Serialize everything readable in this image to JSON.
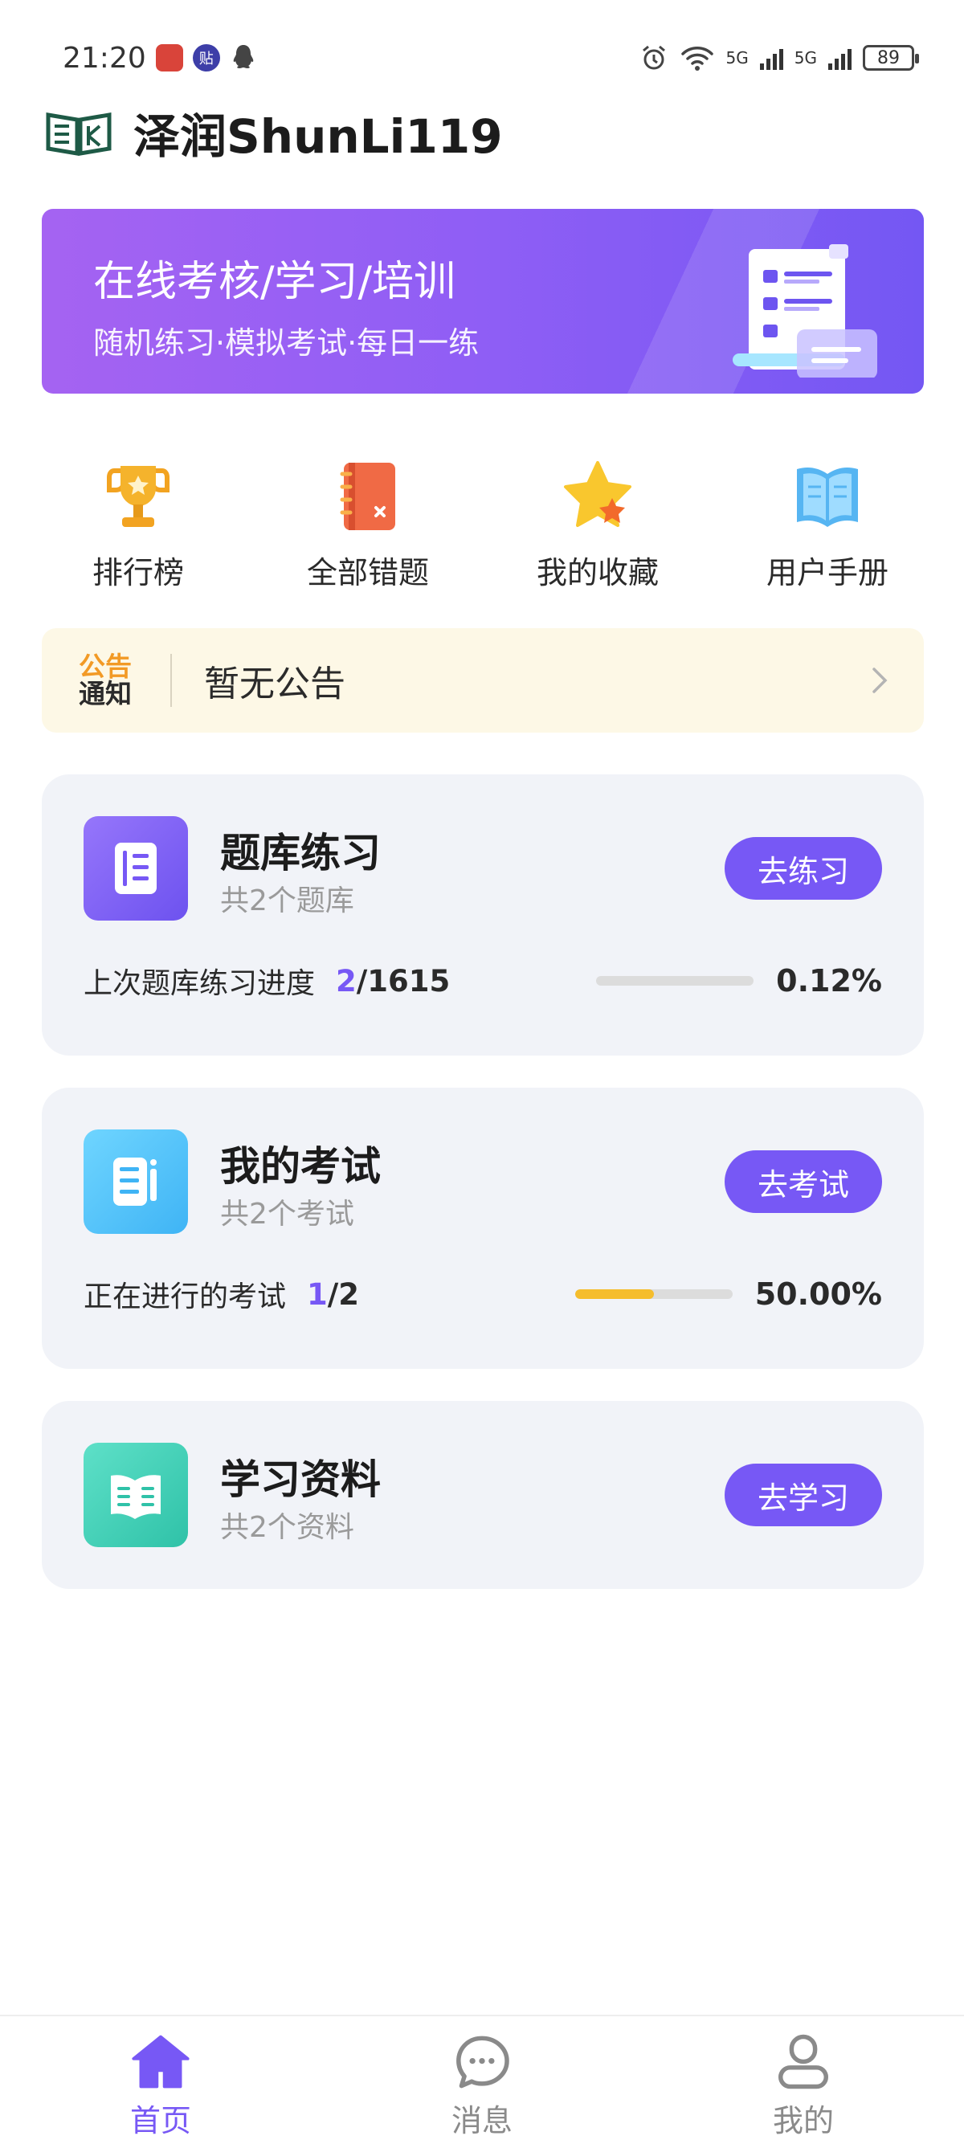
{
  "status_bar": {
    "time": "21:20",
    "app_icon_1": "贴",
    "network_1": "5G",
    "network_2": "5G",
    "battery": "89"
  },
  "header": {
    "app_title": "泽润ShunLi119"
  },
  "banner": {
    "title": "在线考核/学习/培训",
    "subtitle": "随机练习·模拟考试·每日一练"
  },
  "quick_menu": [
    {
      "label": "排行榜",
      "icon": "trophy-icon"
    },
    {
      "label": "全部错题",
      "icon": "notebook-icon"
    },
    {
      "label": "我的收藏",
      "icon": "star-icon"
    },
    {
      "label": "用户手册",
      "icon": "book-icon"
    }
  ],
  "notice": {
    "tag_line1": "公告",
    "tag_line2": "通知",
    "text": "暂无公告"
  },
  "cards": {
    "practice": {
      "title": "题库练习",
      "subtitle": "共2个题库",
      "button": "去练习",
      "progress_label": "上次题库练习进度",
      "progress_current": "2",
      "progress_total": "/1615",
      "progress_percent": "0.12%",
      "progress_fraction": 0.0012
    },
    "exam": {
      "title": "我的考试",
      "subtitle": "共2个考试",
      "button": "去考试",
      "progress_label": "正在进行的考试",
      "progress_current": "1",
      "progress_total": "/2",
      "progress_percent": "50.00%",
      "progress_fraction": 0.5
    },
    "materials": {
      "title": "学习资料",
      "subtitle": "共2个资料",
      "button": "去学习"
    }
  },
  "bottom_nav": [
    {
      "label": "首页",
      "icon": "home-icon",
      "active": true
    },
    {
      "label": "消息",
      "icon": "message-icon",
      "active": false
    },
    {
      "label": "我的",
      "icon": "profile-icon",
      "active": false
    }
  ],
  "colors": {
    "accent": "#7758f5",
    "progress_fill": "#f5bd2c",
    "notice_bg": "#fdf8e6"
  }
}
